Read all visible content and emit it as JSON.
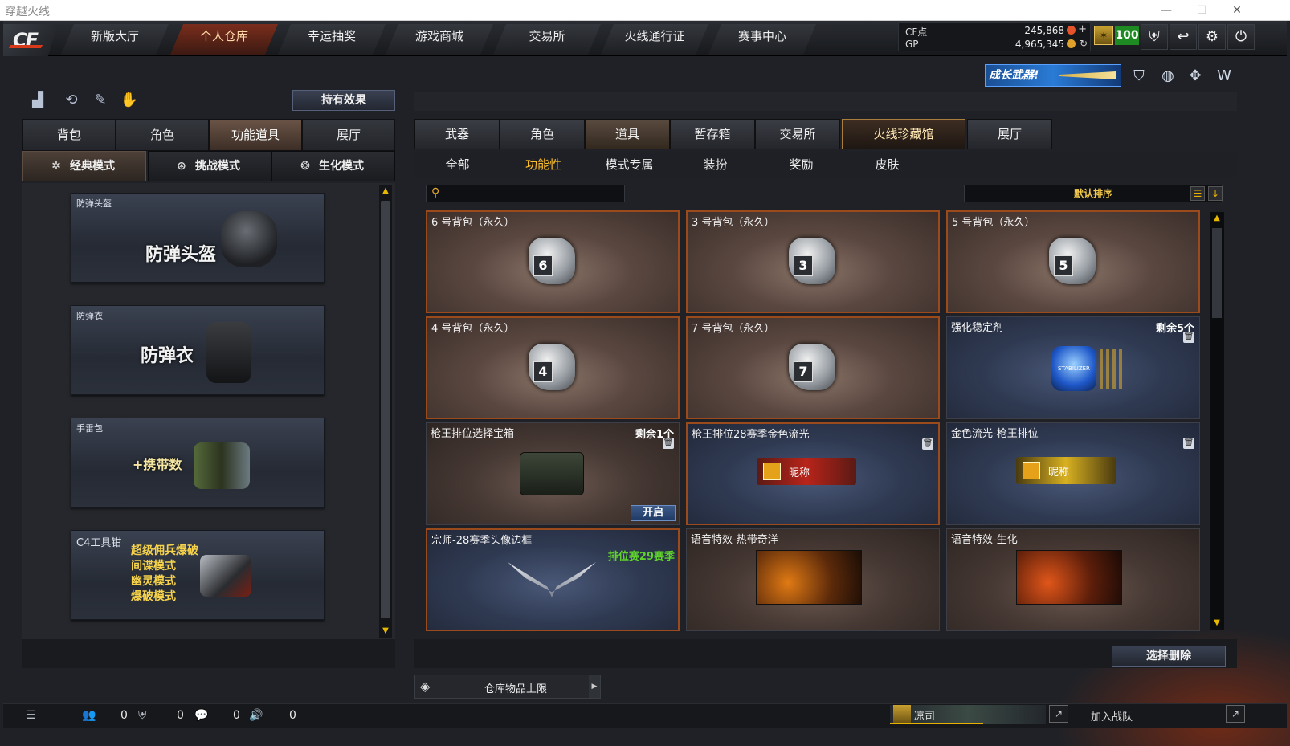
{
  "window": {
    "title": "穿越火线",
    "minimize": "—",
    "maximize": "☐",
    "close": "✕"
  },
  "nav": {
    "logo": "CF",
    "items": [
      "新版大厅",
      "个人仓库",
      "幸运抽奖",
      "游戏商城",
      "交易所",
      "火线通行证",
      "赛事中心"
    ],
    "active_index": 1
  },
  "currency": {
    "cf_label": "CF点",
    "cf_value": "245,868",
    "gp_label": "GP",
    "gp_value": "4,965,345",
    "level": "100"
  },
  "top_icons": [
    "shield-badge-icon",
    "return-icon",
    "gear-icon",
    "power-icon"
  ],
  "growth_banner": "成长武器!",
  "left": {
    "effect_button": "持有效果",
    "tabs": [
      "背包",
      "角色",
      "功能道具",
      "展厅"
    ],
    "selected_tab": 2,
    "modes": [
      "经典模式",
      "挑战模式",
      "生化模式"
    ],
    "selected_mode": 0,
    "items": [
      {
        "caption": "防弹头盔",
        "big": "防弹头盔"
      },
      {
        "caption": "防弹衣",
        "big": "防弹衣"
      },
      {
        "caption": "手雷包",
        "big": "+携带数"
      },
      {
        "caption": "C4工具钳",
        "lines": [
          "超级佣兵爆破",
          "间谍模式",
          "幽灵模式",
          "爆破模式"
        ]
      }
    ]
  },
  "right": {
    "tabs": [
      "武器",
      "角色",
      "道具",
      "暂存箱",
      "交易所",
      "火线珍藏馆",
      "展厅"
    ],
    "selected_tab": 2,
    "filters": [
      "全部",
      "功能性",
      "模式专属",
      "装扮",
      "奖励",
      "皮肤"
    ],
    "selected_filter": 1,
    "sort_label": "默认排序",
    "cards": [
      {
        "name": "6 号背包（永久）",
        "bag": "6"
      },
      {
        "name": "3 号背包（永久）",
        "bag": "3"
      },
      {
        "name": "5 号背包（永久）",
        "bag": "5"
      },
      {
        "name": "4 号背包（永久）",
        "bag": "4"
      },
      {
        "name": "7 号背包（永久）",
        "bag": "7"
      },
      {
        "name": "强化稳定剂",
        "remain": "剩余5个",
        "img": "STABILIZER"
      },
      {
        "name": "枪王排位选择宝箱",
        "remain": "剩余1个",
        "open": "开启"
      },
      {
        "name": "枪王排位28赛季金色流光",
        "nick": "昵称"
      },
      {
        "name": "金色流光-枪王排位",
        "nick": "昵称"
      },
      {
        "name": "宗师-28赛季头像边框",
        "badge": "排位赛29赛季"
      },
      {
        "name": "语音特效-热带奇洋"
      },
      {
        "name": "语音特效-生化"
      }
    ],
    "delete_button": "选择删除",
    "limit_label": "仓库物品上限"
  },
  "status": {
    "counts": [
      "0",
      "0",
      "0",
      "0"
    ],
    "clan_name": "凉司",
    "join": "加入战队"
  },
  "colors": {
    "accent": "#ffbf29",
    "border_orange": "#9b4a1c",
    "level_green": "#1d8a22"
  }
}
